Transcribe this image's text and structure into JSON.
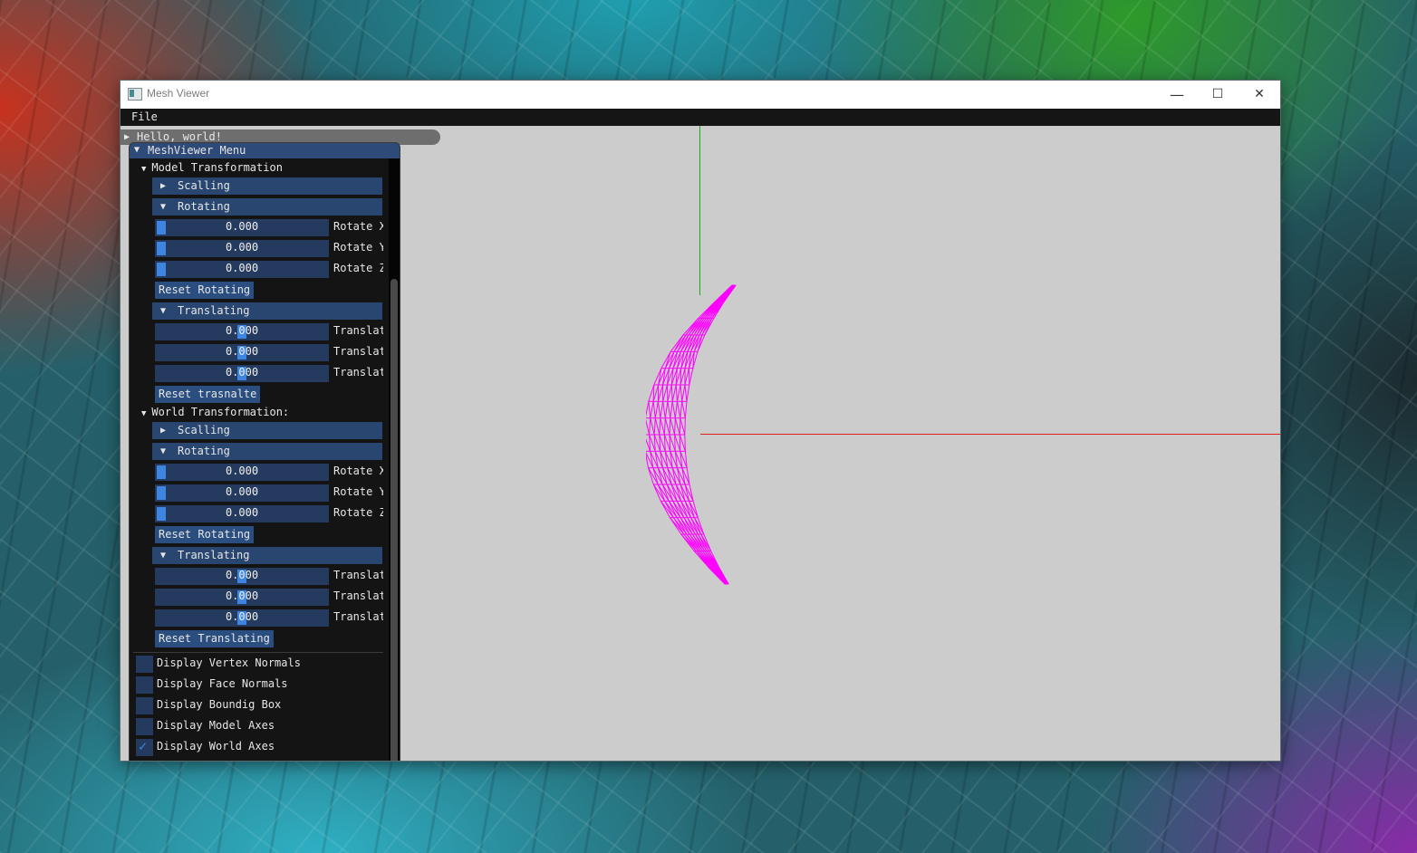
{
  "window": {
    "title": "Mesh Viewer",
    "controls": {
      "minimize": "—",
      "maximize": "☐",
      "close": "✕"
    }
  },
  "menubar": {
    "file": "File"
  },
  "hello_window": {
    "title": "Hello, world!"
  },
  "panel": {
    "title": "MeshViewer Menu",
    "model": {
      "label": "Model Transformation",
      "scaling": "Scalling",
      "rotating": "Rotating",
      "rotate_sliders": [
        {
          "value": "0.000",
          "label": "Rotate X",
          "fraction": 0.0
        },
        {
          "value": "0.000",
          "label": "Rotate Y",
          "fraction": 0.0
        },
        {
          "value": "0.000",
          "label": "Rotate Z",
          "fraction": 0.0
        }
      ],
      "reset_rotating": "Reset Rotating",
      "translating": "Translating",
      "translate_sliders": [
        {
          "value": "0.000",
          "label": "Translate X",
          "fraction": 0.5
        },
        {
          "value": "0.000",
          "label": "Translate Y",
          "fraction": 0.5
        },
        {
          "value": "0.000",
          "label": "Translate Z",
          "fraction": 0.5
        }
      ],
      "reset_translate": "Reset trasnalte"
    },
    "world": {
      "label": "World Transformation:",
      "scaling": "Scalling",
      "rotating": "Rotating",
      "rotate_sliders": [
        {
          "value": "0.000",
          "label": "Rotate X",
          "fraction": 0.0
        },
        {
          "value": "0.000",
          "label": "Rotate Y",
          "fraction": 0.0
        },
        {
          "value": "0.000",
          "label": "Rotate Z",
          "fraction": 0.0
        }
      ],
      "reset_rotating": "Reset Rotating",
      "translating": "Translating",
      "translate_sliders": [
        {
          "value": "0.000",
          "label": "Translate X",
          "fraction": 0.5
        },
        {
          "value": "0.000",
          "label": "Translate Y",
          "fraction": 0.5
        },
        {
          "value": "0.000",
          "label": "Translate Z",
          "fraction": 0.5
        }
      ],
      "reset_translate": "Reset Translating"
    },
    "checkboxes": [
      {
        "label": "Display Vertex Normals",
        "checked": false
      },
      {
        "label": "Display Face Normals",
        "checked": false
      },
      {
        "label": "Display Boundig Box",
        "checked": false
      },
      {
        "label": "Display Model Axes",
        "checked": false
      },
      {
        "label": "Display World Axes",
        "checked": true
      }
    ]
  },
  "viewport": {
    "mesh_color": "#ff00ff",
    "world_x_axis_color": "#e01b1b",
    "world_y_axis_color": "#12b012"
  },
  "icons": {
    "expanded": "▼",
    "collapsed": "▶",
    "check": "✓"
  }
}
